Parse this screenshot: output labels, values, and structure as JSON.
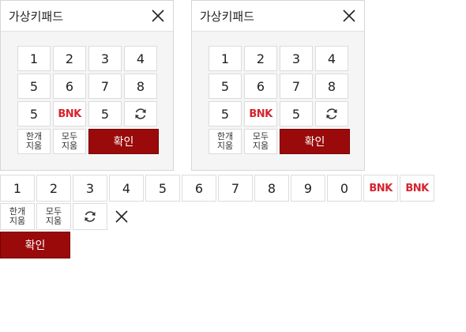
{
  "keypads": [
    {
      "title": "가상키패드",
      "keys_row1": [
        "1",
        "2",
        "3",
        "4"
      ],
      "keys_row2": [
        "5",
        "6",
        "7",
        "8"
      ],
      "keys_row3_left": "5",
      "keys_row3_logo": "BNK",
      "keys_row3_mid": "5",
      "delete_one": "한개\n지움",
      "delete_all": "모두\n지움",
      "confirm": "확인"
    },
    {
      "title": "가상키패드",
      "keys_row1": [
        "1",
        "2",
        "3",
        "4"
      ],
      "keys_row2": [
        "5",
        "6",
        "7",
        "8"
      ],
      "keys_row3_left": "5",
      "keys_row3_logo": "BNK",
      "keys_row3_mid": "5",
      "delete_one": "한개\n지움",
      "delete_all": "모두\n지움",
      "confirm": "확인"
    }
  ],
  "strip": {
    "digits": [
      "1",
      "2",
      "3",
      "4",
      "5",
      "6",
      "7",
      "8",
      "9",
      "0"
    ],
    "logos": [
      "BNK",
      "BNK"
    ],
    "delete_one": "한개\n지움",
    "delete_all": "모두\n지움",
    "confirm": "확인"
  },
  "icons": {
    "close": "close-icon",
    "refresh": "refresh-icon"
  },
  "colors": {
    "confirm_bg": "#9a0a0a",
    "logo": "#d6242e"
  }
}
